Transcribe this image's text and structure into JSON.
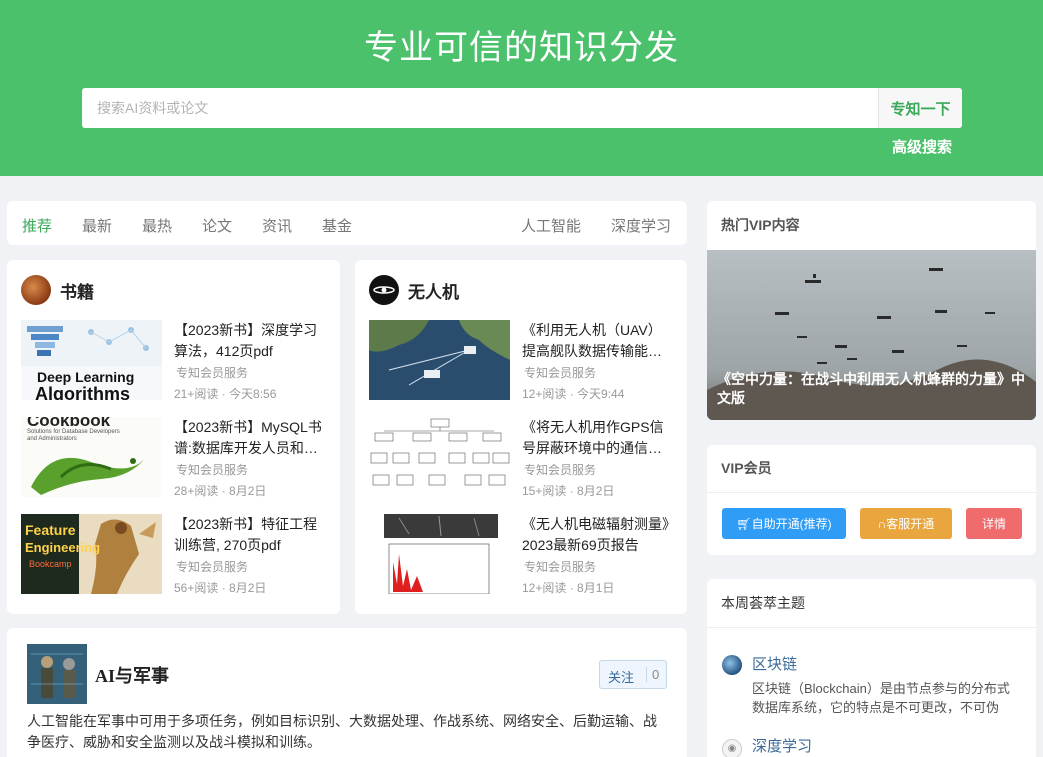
{
  "hero": {
    "title": "专业可信的知识分发",
    "search_placeholder": "搜索AI资料或论文",
    "search_button": "专知一下",
    "advanced_search": "高级搜索"
  },
  "tabs": {
    "left": [
      "推荐",
      "最新",
      "最热",
      "论文",
      "资讯",
      "基金"
    ],
    "right": [
      "人工智能",
      "深度学习"
    ],
    "active_color": "#3aa95a"
  },
  "categories": [
    {
      "name": "书籍",
      "items": [
        {
          "title": "【2023新书】深度学习算法，412页pdf",
          "source": "专知会员服务",
          "meta": "21+阅读 · 今天8:56",
          "thumb_text": [
            "Deep Learning",
            "Algorithms"
          ]
        },
        {
          "title": "【2023新书】MySQL书谱:数据库开发人员和…",
          "source": "专知会员服务",
          "meta": "28+阅读 · 8月2日",
          "thumb_text": [
            "Cookbook",
            "Solutions for Database Developers",
            "and Administrators"
          ]
        },
        {
          "title": "【2023新书】特征工程训练营, 270页pdf",
          "source": "专知会员服务",
          "meta": "56+阅读 · 8月2日",
          "thumb_text": [
            "Feature",
            "Engineering",
            "Bookcamp"
          ]
        }
      ]
    },
    {
      "name": "无人机",
      "items": [
        {
          "title": "《利用无人机（UAV）提高舰队数据传输能…",
          "source": "专知会员服务",
          "meta": "12+阅读 · 今天9:44"
        },
        {
          "title": "《将无人机用作GPS信号屏蔽环境中的通信…",
          "source": "专知会员服务",
          "meta": "15+阅读 · 8月2日"
        },
        {
          "title": "《无人机电磁辐射测量》2023最新69页报告",
          "source": "专知会员服务",
          "meta": "12+阅读 · 8月1日"
        }
      ]
    }
  ],
  "topic": {
    "name": "AI与军事",
    "follow_label": "关注",
    "follow_count": "0",
    "description": "人工智能在军事中可用于多项任务，例如目标识别、大数据处理、作战系统、网络安全、后勤运输、战争医疗、威胁和安全监测以及战斗模拟和训练。"
  },
  "sidebar": {
    "hot_vip_title": "热门VIP内容",
    "hot_vip_caption": "《空中力量：在战斗中利用无人机蜂群的力量》中文版",
    "vip_title": "VIP会员",
    "vip_buttons": [
      {
        "label": "自助开通(推荐)",
        "color": "#2f9cf6",
        "icon": "cart-icon"
      },
      {
        "label": "客服开通",
        "color": "#eaa63e",
        "icon": "headset-icon"
      },
      {
        "label": "详情",
        "color": "#f06b6b"
      }
    ],
    "weekly_title": "本周荟萃主题",
    "weekly_topics": [
      {
        "name": "区块链",
        "desc": "区块链（Blockchain）是由节点参与的分布式数据库系统，它的特点是不可更改，不可伪造，…"
      },
      {
        "name": "深度学习",
        "desc": ""
      }
    ]
  }
}
